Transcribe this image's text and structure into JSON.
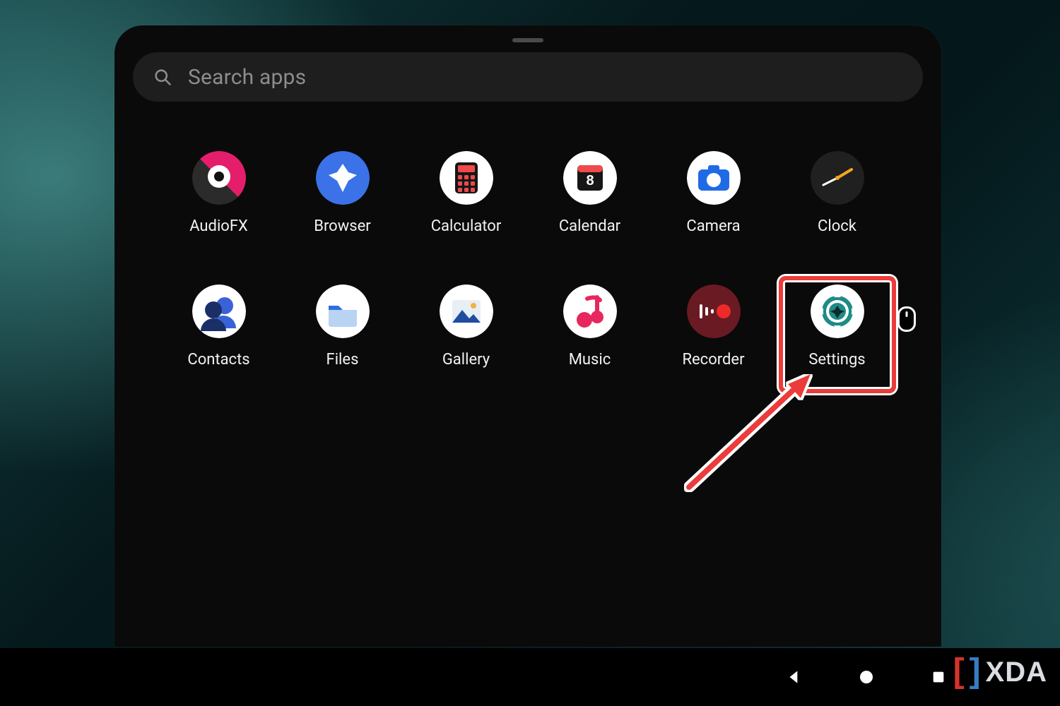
{
  "search": {
    "placeholder": "Search apps"
  },
  "apps": [
    {
      "id": "audiofx",
      "label": "AudioFX"
    },
    {
      "id": "browser",
      "label": "Browser"
    },
    {
      "id": "calculator",
      "label": "Calculator"
    },
    {
      "id": "calendar",
      "label": "Calendar",
      "day": "8"
    },
    {
      "id": "camera",
      "label": "Camera"
    },
    {
      "id": "clock",
      "label": "Clock"
    },
    {
      "id": "contacts",
      "label": "Contacts"
    },
    {
      "id": "files",
      "label": "Files"
    },
    {
      "id": "gallery",
      "label": "Gallery"
    },
    {
      "id": "music",
      "label": "Music"
    },
    {
      "id": "recorder",
      "label": "Recorder"
    },
    {
      "id": "settings",
      "label": "Settings",
      "highlighted": true
    }
  ],
  "annotation": {
    "highlight_target": "settings",
    "arrow": true
  },
  "colors": {
    "highlight_red": "#ec3b3a",
    "drawer_bg": "#0a0a0a",
    "search_bg": "#1e1e1e"
  },
  "watermark": {
    "text": "XDA"
  },
  "navbar": {
    "buttons": [
      "back",
      "home",
      "recent"
    ]
  }
}
